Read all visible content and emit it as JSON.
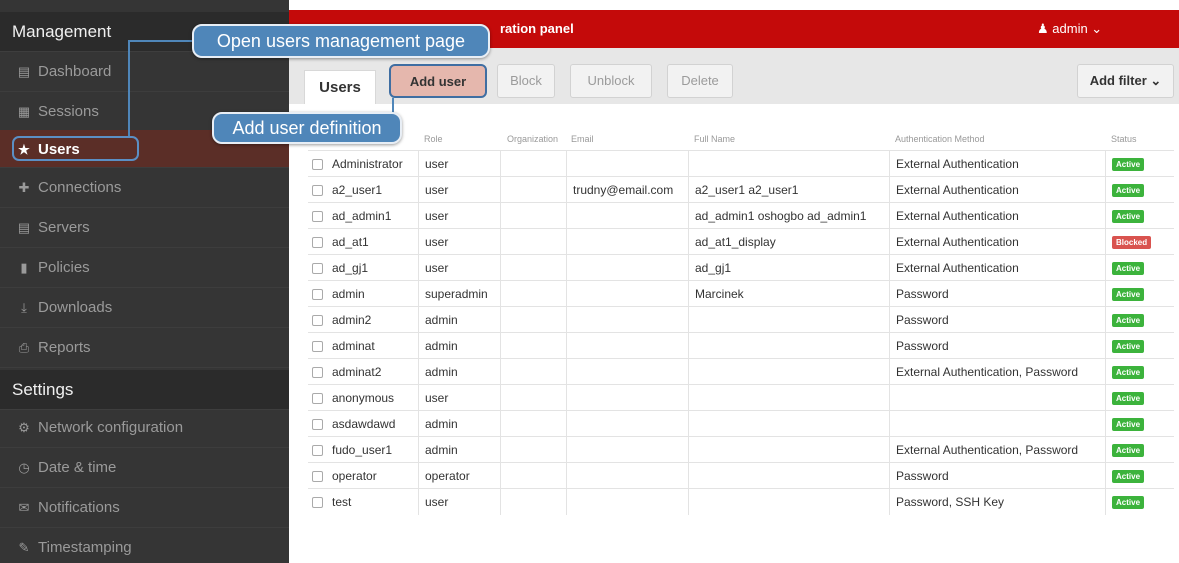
{
  "sidebar": {
    "management_title": "Management",
    "settings_title": "Settings",
    "items": [
      {
        "label": "Dashboard",
        "icon": "dashboard-icon"
      },
      {
        "label": "Sessions",
        "icon": "sessions-icon"
      },
      {
        "label": "Users",
        "icon": "users-icon"
      },
      {
        "label": "Connections",
        "icon": "connections-icon"
      },
      {
        "label": "Servers",
        "icon": "servers-icon"
      },
      {
        "label": "Policies",
        "icon": "shield-icon"
      },
      {
        "label": "Downloads",
        "icon": "download-icon"
      },
      {
        "label": "Reports",
        "icon": "reports-icon"
      }
    ],
    "settings_items": [
      {
        "label": "Network configuration",
        "icon": "gears-icon"
      },
      {
        "label": "Date & time",
        "icon": "clock-icon"
      },
      {
        "label": "Notifications",
        "icon": "envelope-icon"
      },
      {
        "label": "Timestamping",
        "icon": "pencil-icon"
      }
    ]
  },
  "header": {
    "panel_title": "ration panel",
    "user_label": "admin ⌄",
    "accent": "#c40a0a"
  },
  "toolbar": {
    "tab_users": "Users",
    "add_user": "Add user",
    "block": "Block",
    "unblock": "Unblock",
    "delete": "Delete",
    "add_filter": "Add filter ⌄"
  },
  "callouts": {
    "users": "Open users management page",
    "add_user": "Add user definition"
  },
  "table": {
    "columns": [
      "Role",
      "Organization",
      "Email",
      "Full Name",
      "Authentication Method",
      "Status"
    ],
    "rows": [
      {
        "login": "Administrator",
        "role": "user",
        "org": "",
        "email": "",
        "fullname": "",
        "auth": "External Authentication",
        "status": "Active"
      },
      {
        "login": "a2_user1",
        "role": "user",
        "org": "",
        "email": "trudny@email.com",
        "fullname": "a2_user1 a2_user1",
        "auth": "External Authentication",
        "status": "Active"
      },
      {
        "login": "ad_admin1",
        "role": "user",
        "org": "",
        "email": "",
        "fullname": "ad_admin1 oshogbo ad_admin1",
        "auth": "External Authentication",
        "status": "Active"
      },
      {
        "login": "ad_at1",
        "role": "user",
        "org": "",
        "email": "",
        "fullname": "ad_at1_display",
        "auth": "External Authentication",
        "status": "Blocked"
      },
      {
        "login": "ad_gj1",
        "role": "user",
        "org": "",
        "email": "",
        "fullname": "ad_gj1",
        "auth": "External Authentication",
        "status": "Active"
      },
      {
        "login": "admin",
        "role": "superadmin",
        "org": "",
        "email": "",
        "fullname": "Marcinek",
        "auth": "Password",
        "status": "Active"
      },
      {
        "login": "admin2",
        "role": "admin",
        "org": "",
        "email": "",
        "fullname": "",
        "auth": "Password",
        "status": "Active"
      },
      {
        "login": "adminat",
        "role": "admin",
        "org": "",
        "email": "",
        "fullname": "",
        "auth": "Password",
        "status": "Active"
      },
      {
        "login": "adminat2",
        "role": "admin",
        "org": "",
        "email": "",
        "fullname": "",
        "auth": "External Authentication, Password",
        "status": "Active"
      },
      {
        "login": "anonymous",
        "role": "user",
        "org": "",
        "email": "",
        "fullname": "",
        "auth": "",
        "status": "Active"
      },
      {
        "login": "asdawdawd",
        "role": "admin",
        "org": "",
        "email": "",
        "fullname": "",
        "auth": "",
        "status": "Active"
      },
      {
        "login": "fudo_user1",
        "role": "admin",
        "org": "",
        "email": "",
        "fullname": "",
        "auth": "External Authentication, Password",
        "status": "Active"
      },
      {
        "login": "operator",
        "role": "operator",
        "org": "",
        "email": "",
        "fullname": "",
        "auth": "Password",
        "status": "Active"
      },
      {
        "login": "test",
        "role": "user",
        "org": "",
        "email": "",
        "fullname": "",
        "auth": "Password, SSH Key",
        "status": "Active"
      }
    ]
  }
}
